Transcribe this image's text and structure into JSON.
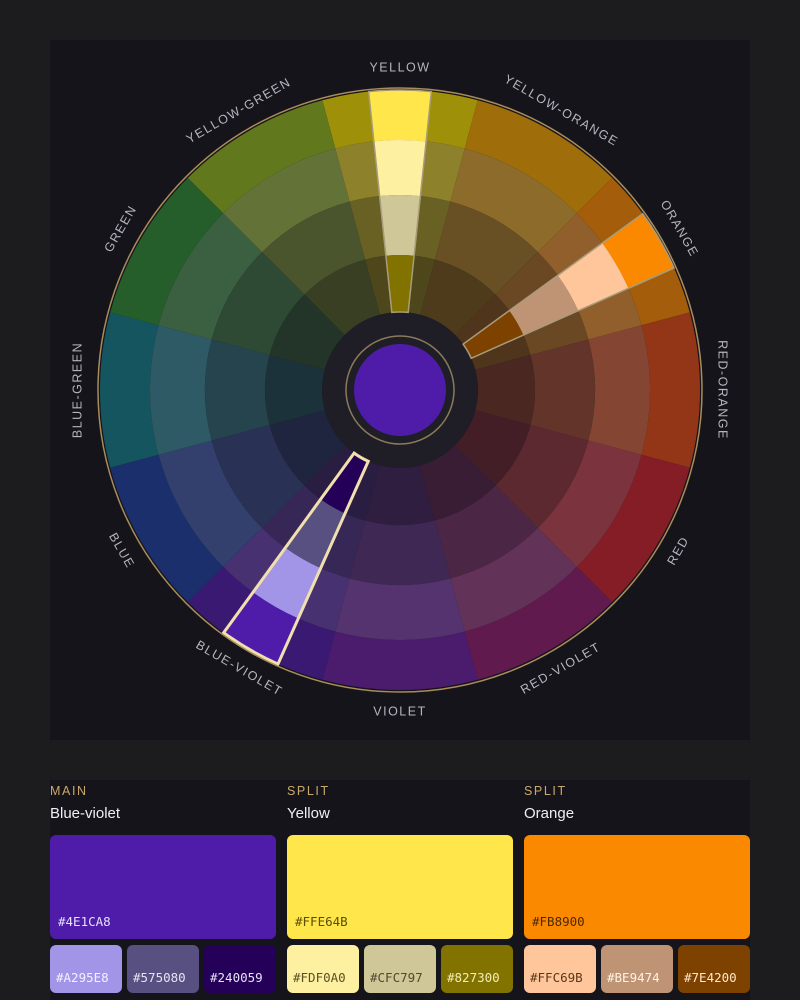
{
  "wheel": {
    "labels": [
      "YELLOW",
      "YELLOW-ORANGE",
      "ORANGE",
      "RED-ORANGE",
      "RED",
      "RED-VIOLET",
      "VIOLET",
      "BLUE-VIOLET",
      "BLUE",
      "BLUE-GREEN",
      "GREEN",
      "YELLOW-GREEN"
    ],
    "hues": [
      "#f3dc00",
      "#f3a500",
      "#fb8900",
      "#e04b14",
      "#c8232c",
      "#8f1d6e",
      "#6b1fa0",
      "#4e1ca8",
      "#1e3f9e",
      "#127d8a",
      "#2e8c34",
      "#8fb71c"
    ],
    "center_color": "#4e1ca8",
    "selected": [
      {
        "index": 0,
        "shades": [
          "#fdf0a0",
          "#cfc797",
          "#827300"
        ],
        "main": "#ffe64b"
      },
      {
        "index": 2,
        "shades": [
          "#ffc69b",
          "#be9474",
          "#7e4200"
        ],
        "main": "#fb8900"
      },
      {
        "index": 7,
        "shades": [
          "#a295e8",
          "#575080",
          "#240059"
        ],
        "main": "#4e1ca8"
      }
    ]
  },
  "palette": [
    {
      "role": "MAIN",
      "name": "Blue-violet",
      "hex": "#4E1CA8",
      "text_color": "#e7e0ff",
      "shades": [
        {
          "hex": "#A295E8",
          "text_color": "#f4f1ff"
        },
        {
          "hex": "#575080",
          "text_color": "#e6e3f3"
        },
        {
          "hex": "#240059",
          "text_color": "#e6e0f5"
        }
      ]
    },
    {
      "role": "SPLIT",
      "name": "Yellow",
      "hex": "#FFE64B",
      "text_color": "#5a4d06",
      "shades": [
        {
          "hex": "#FDF0A0",
          "text_color": "#5a5122"
        },
        {
          "hex": "#CFC797",
          "text_color": "#4f4a30"
        },
        {
          "hex": "#827300",
          "text_color": "#f5ecb3"
        }
      ]
    },
    {
      "role": "SPLIT",
      "name": "Orange",
      "hex": "#FB8900",
      "text_color": "#4d2800",
      "shades": [
        {
          "hex": "#FFC69B",
          "text_color": "#5b3718"
        },
        {
          "hex": "#BE9474",
          "text_color": "#fff3e7"
        },
        {
          "hex": "#7E4200",
          "text_color": "#ffe6c9"
        }
      ]
    }
  ]
}
